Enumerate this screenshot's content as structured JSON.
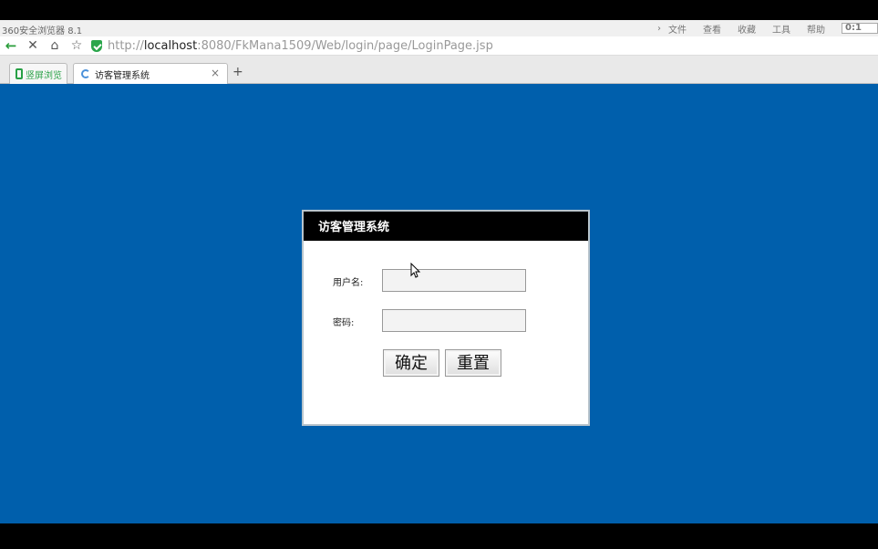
{
  "browser": {
    "title": "360安全浏览器 8.1",
    "menu": [
      "文件",
      "查看",
      "收藏",
      "工具",
      "帮助"
    ],
    "clock": "0:1",
    "url_prefix": "http://",
    "url_host": "localhost",
    "url_rest": ":8080/FkMana1509/Web/login/page/LoginPage.jsp",
    "icons": {
      "back": "back-arrow-icon",
      "stop": "close-icon",
      "home": "home-icon",
      "favorite": "star-icon",
      "security": "shield-icon"
    }
  },
  "tabs": [
    {
      "label": "竖屏浏览",
      "icon": "phone-icon"
    },
    {
      "label": "访客管理系统",
      "icon": "loading-spinner-icon"
    }
  ],
  "login": {
    "title": "访客管理系统",
    "username_label": "用户名:",
    "password_label": "密码:",
    "username_value": "",
    "password_value": "",
    "confirm_button": "确定",
    "reset_button": "重置"
  },
  "colors": {
    "page_background": "#005fac",
    "dialog_header": "#000000",
    "dialog_background": "#ffffff"
  }
}
